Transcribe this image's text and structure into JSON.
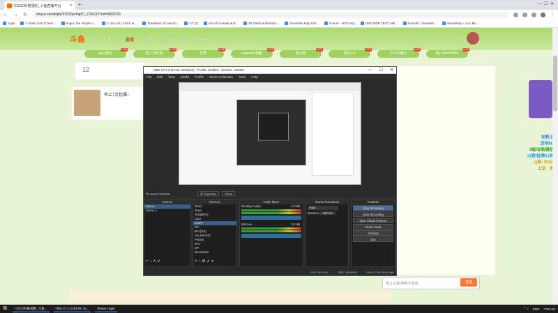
{
  "browser": {
    "tab_title": "CSGO科技福利_斗鱼直播平台",
    "url": "douyu.com/topic/2022SpringST_CSGOZ?rid=5820215",
    "bookmarks": [
      "Apps",
      "A Giant List of Over...",
      "imgur: the simple o...",
      "1 Line Art | ASCII ar...",
      "Translator @ ascnto...",
      "AT (1)",
      "List of Animals and...",
      "20 Satirical Illustrati...",
      "Scientists Map Out...",
      "Forum - HLTV.org",
      "UNICODE TEST v48...",
      "Dave2k / cheaters...",
      "SteamRep » LoL Bo..."
    ]
  },
  "site": {
    "logo": "斗鱼",
    "nav": [
      "首页",
      "直播",
      "分类",
      "视频",
      "游戏",
      "鱼吧"
    ],
    "live_tabs": [
      "diyu测试",
      "硕丁沃料影",
      "豆梦",
      "saisda红利猫",
      "蔡小楼",
      "看云CS",
      "CSGO摄头",
      "我儿MIRANDA"
    ],
    "stat_number": "12",
    "card_title": "早上7点比赛~",
    "promo_lines": [
      "钻粉上车",
      "送场600+",
      "9级/钻粉微信群",
      "火箭/徒牌12房管",
      "Q群: 956995",
      "上钻 · 鱼吧"
    ],
    "chat_placeholder": "发主主播    畅畅不说话",
    "send_label": "发送"
  },
  "obs": {
    "title": "OBS 27.2.3 (64-bit, windows) - Profile: Untitled - Scenes: Untitled",
    "menu": [
      "File",
      "Edit",
      "View",
      "Docks",
      "Profile",
      "Scene Collection",
      "Tools",
      "Help"
    ],
    "no_source": "No source selected",
    "properties": "Properties",
    "filters": "Filters",
    "docks": {
      "scenes": {
        "title": "Scenes",
        "items": [
          "Scene",
          "Scene 2"
        ]
      },
      "sources": {
        "title": "Sources",
        "items": [
          "Text1",
          "Text2",
          "Text(BPC)",
          "Cam",
          "Game",
          "GC",
          "BF1(GS)",
          "VALORANT",
          "Phasm",
          "SFV",
          "SP",
          "Overwatch",
          "Image"
        ]
      },
      "mixer": {
        "title": "Audio Mixer",
        "tracks": [
          {
            "name": "Desktop Audio",
            "db": "-1.0 dB"
          },
          {
            "name": "Mic/Aux",
            "db": "0.0 dB"
          }
        ]
      },
      "transitions": {
        "title": "Scene Transitions",
        "type": "Fade",
        "duration_label": "Duration",
        "duration": "300 ms"
      },
      "controls": {
        "title": "Controls",
        "buttons": [
          "Stop Streaming",
          "Start Recording",
          "Start Virtual Camera",
          "Studio Mode",
          "Settings",
          "Exit"
        ]
      }
    },
    "status": {
      "live": "LIVE: 00:00:00",
      "rec": "REC: 00:00:00",
      "cpu": "CPU: 0.7%, 59.94 fps"
    }
  },
  "taskbar": {
    "apps": [
      "CSGO科技福利_斗鱼...",
      "OBS 27.2.3 (64-bit, wi...",
      "Steam Login"
    ],
    "lang": "ENG",
    "time": "7:00 AM"
  }
}
